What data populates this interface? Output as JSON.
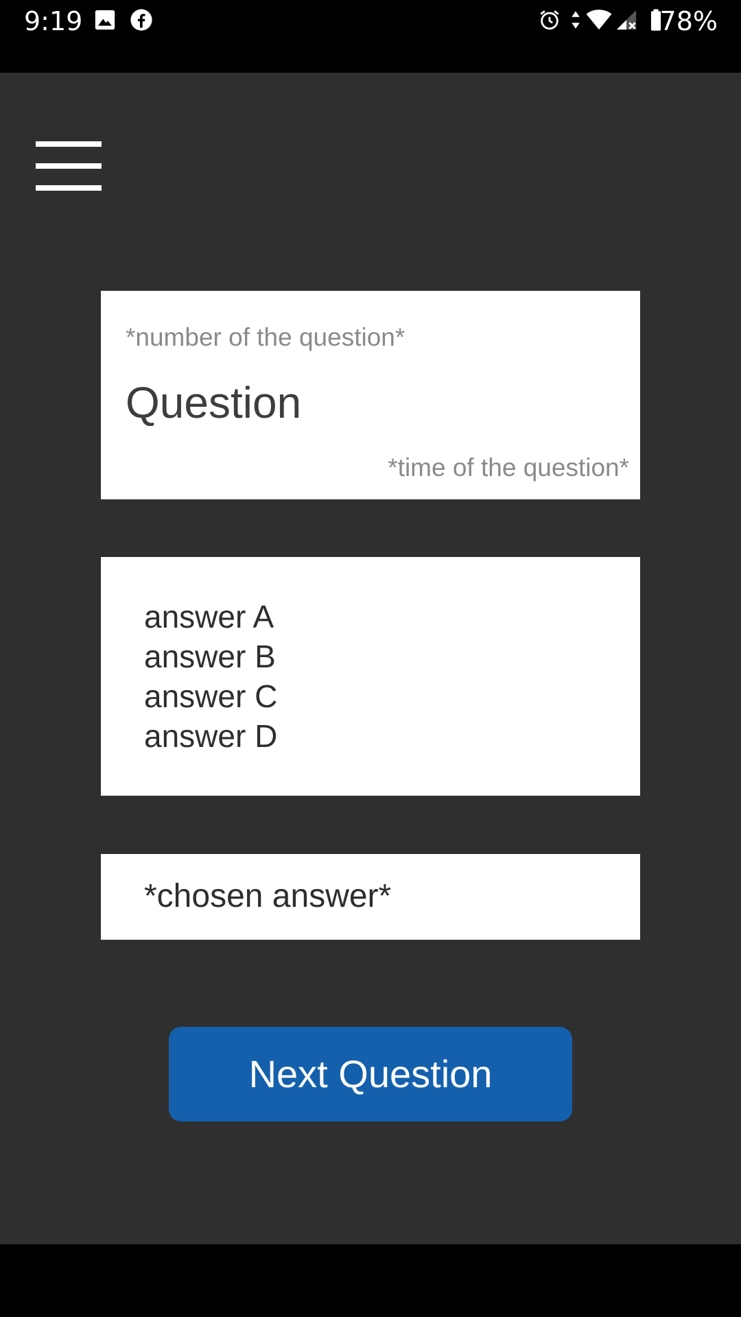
{
  "status_bar": {
    "time": "9:19",
    "battery_percent": "78%",
    "icons": [
      "image-icon",
      "facebook-icon",
      "alarm-icon",
      "data-transfer-icon",
      "wifi-icon",
      "signal-icon",
      "battery-icon"
    ]
  },
  "toolbar": {
    "menu_icon": "hamburger-menu-icon"
  },
  "question": {
    "number": "*number of the question*",
    "text": "Question",
    "time": "*time of the question*"
  },
  "answers": [
    "answer A",
    "answer B",
    "answer C",
    "answer D"
  ],
  "chosen_answer": "*chosen answer*",
  "next_button": {
    "label": "Next Question",
    "color": "#1460ad"
  },
  "colors": {
    "app_background": "#2f2f2f",
    "card_background": "#ffffff"
  }
}
